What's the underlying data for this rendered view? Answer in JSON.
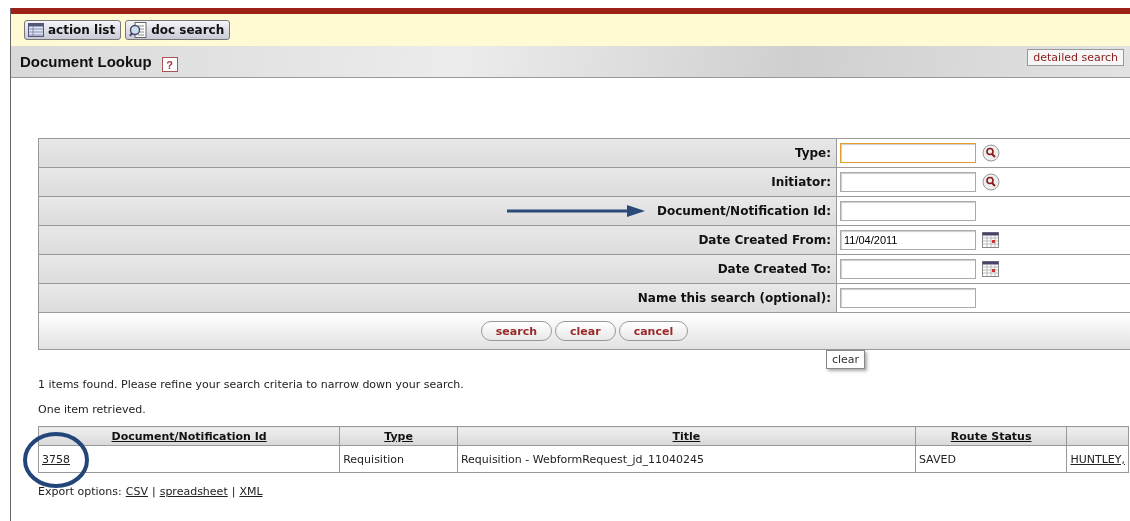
{
  "toolbar": {
    "buttons": [
      {
        "label": "action list"
      },
      {
        "label": "doc search"
      }
    ]
  },
  "header": {
    "title": "Document Lookup",
    "help": "?",
    "detailed_search": "detailed search"
  },
  "form": {
    "fields": [
      {
        "label": "Type:",
        "kind": "lookup",
        "focused": true
      },
      {
        "label": "Initiator:",
        "kind": "lookup",
        "focused": false
      },
      {
        "label": "Document/Notification Id:",
        "kind": "plain",
        "focused": false,
        "annotated": true
      },
      {
        "label": "Date Created From:",
        "kind": "calendar",
        "value": "11/04/2011",
        "focused": false
      },
      {
        "label": "Date Created To:",
        "kind": "calendar",
        "focused": false
      },
      {
        "label": "Name this search (optional):",
        "kind": "plain",
        "focused": false
      }
    ],
    "buttons": [
      "search",
      "clear",
      "cancel"
    ],
    "tooltip": "clear"
  },
  "messages": [
    "1 items found. Please refine your search criteria to narrow down your search.",
    "One item retrieved."
  ],
  "results": {
    "columns": [
      "Document/Notification Id",
      "Type",
      "Title",
      "Route Status",
      ""
    ],
    "rows": [
      {
        "cells": [
          "3758",
          "Requisition",
          "Requisition - WebformRequest_jd_11040245",
          "SAVED",
          "HUNTLEY,"
        ],
        "annotated": true
      }
    ]
  },
  "export": {
    "label": "Export options:",
    "items": [
      {
        "kind": "link",
        "text": "CSV"
      },
      {
        "kind": "separator",
        "text": "|"
      },
      {
        "kind": "link",
        "text": "spreadsheet"
      },
      {
        "kind": "separator",
        "text": "|"
      },
      {
        "kind": "link",
        "text": "XML"
      }
    ]
  }
}
